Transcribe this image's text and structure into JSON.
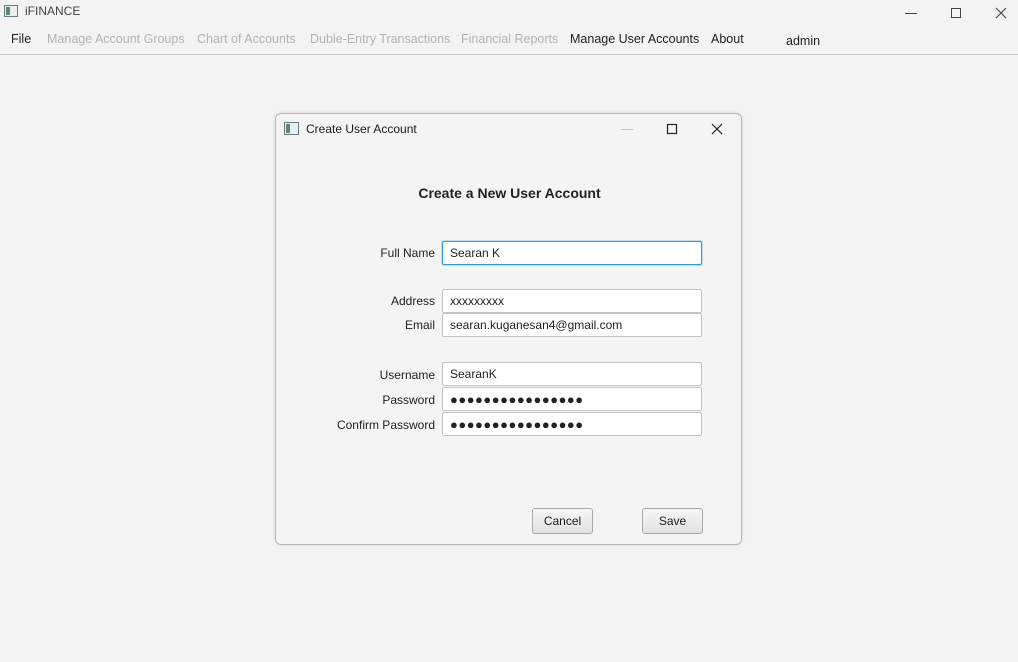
{
  "window": {
    "title": "iFINANCE"
  },
  "menu": {
    "items": [
      {
        "label": "File",
        "enabled": true
      },
      {
        "label": "Manage Account Groups",
        "enabled": false
      },
      {
        "label": "Chart of Accounts",
        "enabled": false
      },
      {
        "label": "Duble-Entry Transactions",
        "enabled": false
      },
      {
        "label": "Financial Reports",
        "enabled": false
      },
      {
        "label": "Manage User Accounts",
        "enabled": true
      },
      {
        "label": "About",
        "enabled": true
      }
    ],
    "current_user": "admin"
  },
  "dialog": {
    "title": "Create User Account",
    "heading": "Create a New User Account",
    "fields": {
      "full_name": {
        "label": "Full Name",
        "value": "Searan K"
      },
      "address": {
        "label": "Address",
        "value": "xxxxxxxxx"
      },
      "email": {
        "label": "Email",
        "value": "searan.kuganesan4@gmail.com"
      },
      "username": {
        "label": "Username",
        "value": "SearanK"
      },
      "password": {
        "label": "Password",
        "value": "●●●●●●●●●●●●●●●●"
      },
      "confirm_password": {
        "label": "Confirm Password",
        "value": "●●●●●●●●●●●●●●●●"
      }
    },
    "buttons": {
      "cancel": "Cancel",
      "save": "Save"
    }
  },
  "colors": {
    "background": "#f3f3f3",
    "focus_border": "#2b9be0",
    "disabled_text": "#b3b3b3"
  }
}
